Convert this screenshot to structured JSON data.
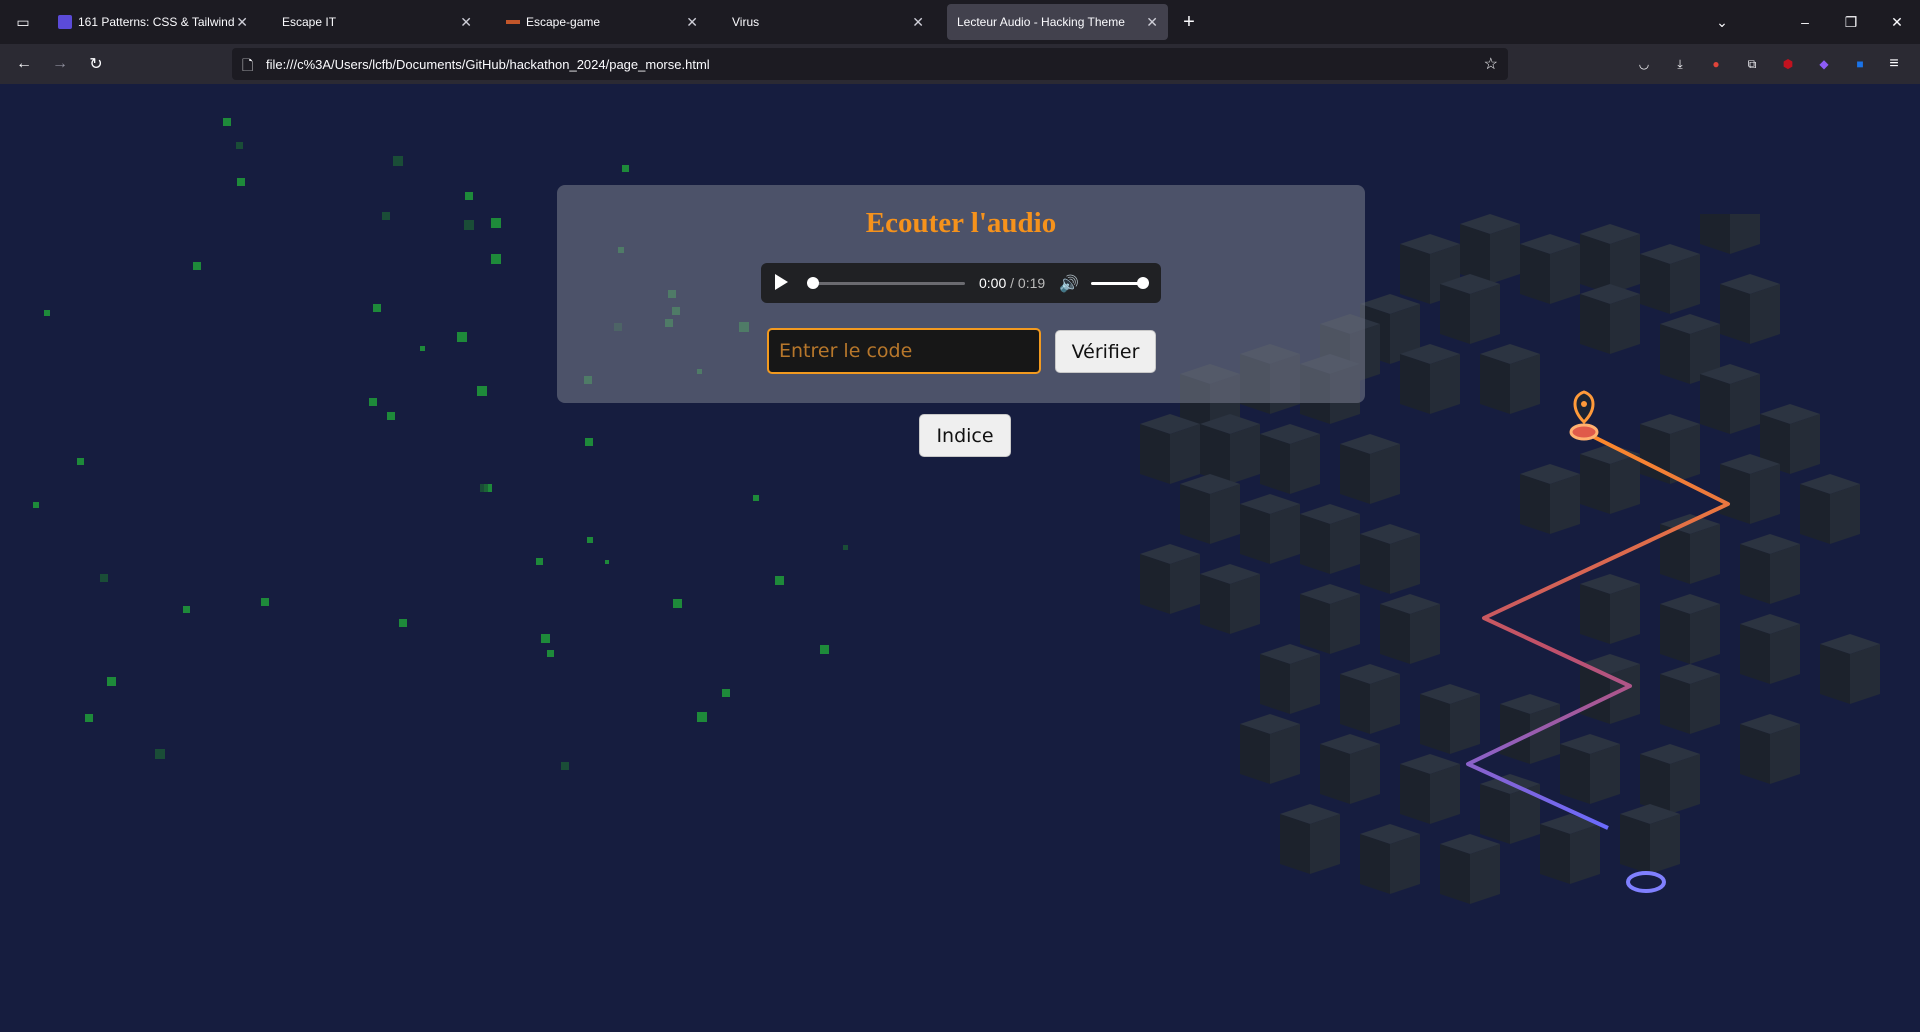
{
  "browser": {
    "tabs": [
      {
        "label": "161 Patterns: CSS & Tailwind",
        "active": false
      },
      {
        "label": "Escape IT",
        "active": false
      },
      {
        "label": "Escape-game",
        "active": false
      },
      {
        "label": "Virus",
        "active": false
      },
      {
        "label": "Lecteur Audio - Hacking Theme",
        "active": true
      }
    ],
    "url": "file:///c%3A/Users/lcfb/Documents/GitHub/hackathon_2024/page_morse.html"
  },
  "page": {
    "title": "Ecouter l'audio",
    "audio": {
      "current_time": "0:00",
      "separator": " / ",
      "duration": "0:19",
      "progress": 0.0,
      "volume": 1.0
    },
    "code_input": {
      "placeholder": "Entrer le code",
      "value": ""
    },
    "verify_label": "Vérifier",
    "hint_label": "Indice"
  },
  "colors": {
    "accent": "#f5921c",
    "background": "#161d3f",
    "matrix_green": "#1e8a3a",
    "route_start": "#ff8a2a",
    "route_end": "#6b6bff"
  }
}
